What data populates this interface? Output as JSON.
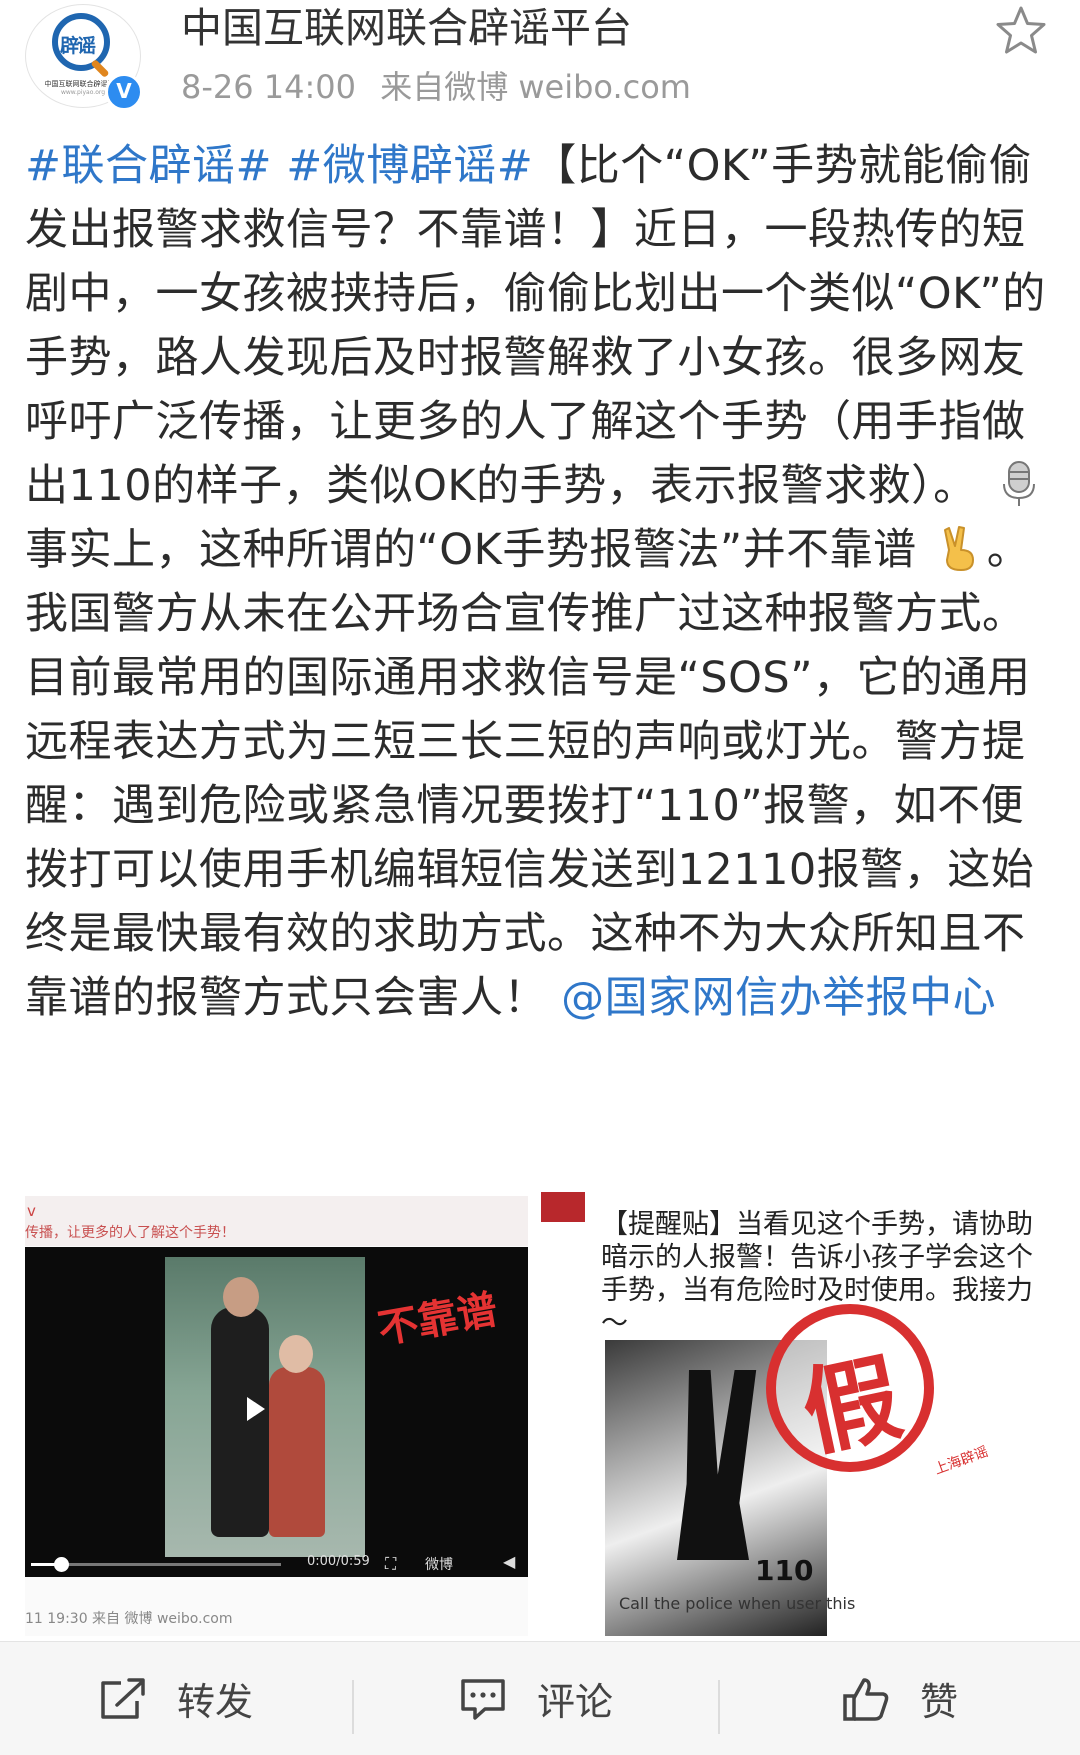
{
  "account": {
    "name": "中国互联网联合辟谣平台",
    "avatar_text": "辟谣",
    "avatar_org": "中国互联网联合辟谣平台",
    "avatar_url": "www.piyao.org",
    "verified_mark": "V"
  },
  "post_meta": {
    "time": "8-26 14:00",
    "source": "来自微博 weibo.com"
  },
  "post": {
    "tag1": "#联合辟谣#",
    "tag2": "#微博辟谣#",
    "text1": "【比个“OK”手势就能偷偷发出报警求救信号？不靠谱！】近日，一段热传的短剧中，一女孩被挟持后，偷偷比划出一个类似“OK”的手势，路人发现后及时报警解救了小女孩。很多网友呼吁广泛传播，让更多的人了解这个手势（用手指做出110的样子，类似OK的手势，表示报警求救）。",
    "text2": "事实上，这种所谓的“OK手势报警法”并不靠谱",
    "text3": "。我国警方从未在公开场合宣传推广过这种报警方式。目前最常用的国际通用求救信号是“SOS”，它的通用远程表达方式为三短三长三短的声响或灯光。警方提醒：遇到危险或紧急情况要拨打“110”报警，如不便拨打可以使用手机编辑短信发送到12110报警，这始终是最快最有效的求助方式。这种不为大众所知且不靠谱的报警方式只会害人！",
    "mention": "@国家网信办举报中心",
    "emoji1": "microphone-emoji",
    "emoji2": "victory-hand-emoji"
  },
  "video": {
    "tiny_label": "v",
    "top_caption": "传播，让更多的人了解这个手势！",
    "stamp": "不靠谱",
    "time": "0:00/0:59",
    "watermark": "微博",
    "progress": 0.12,
    "bottom_caption": "11 19:30  来自 微博 weibo.com"
  },
  "poster": {
    "caption": "【提醒贴】当看见这个手势，请协助暗示的人报警！告诉小孩子学会这个手势，当有危险时及时使用。我接力～",
    "number": "110",
    "small_text": "Call the police when user this",
    "stamp": "假",
    "stamp_sub": "上海辟谣"
  },
  "actions": {
    "repost": "转发",
    "comment": "评论",
    "like": "赞"
  },
  "colors": {
    "link": "#2f77c9",
    "verified": "#2d8cf0",
    "stamp_red": "#d83030"
  }
}
